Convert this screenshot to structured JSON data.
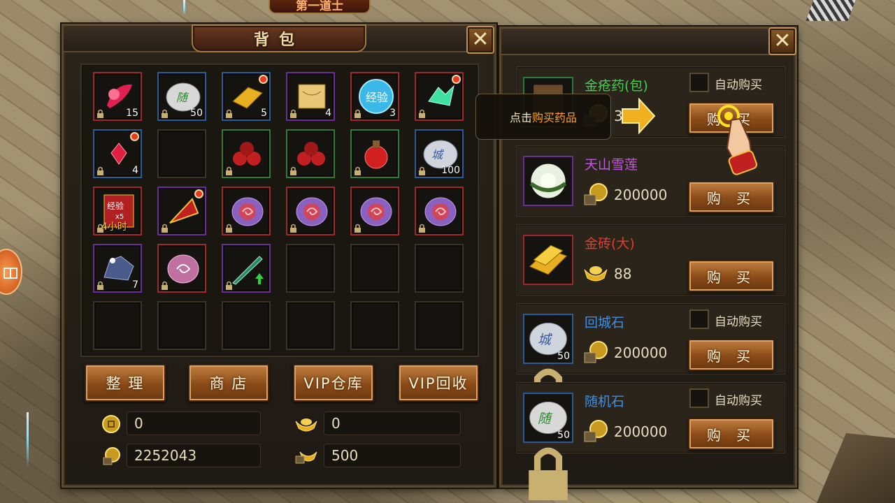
{
  "top_tag": "第一道士",
  "bag": {
    "title": "背包",
    "slots": [
      {
        "count": "15",
        "icon": "red-feather-icon"
      },
      {
        "count": "50",
        "icon": "white-stone-icon"
      },
      {
        "count": "5",
        "icon": "gold-brick-icon"
      },
      {
        "count": "4",
        "icon": "scroll-icon"
      },
      {
        "count": "3",
        "icon": "blue-exp-orb-icon"
      },
      {
        "count": "",
        "icon": "green-crystal-icon"
      },
      {
        "count": "4",
        "icon": "red-gem-icon"
      },
      {
        "count": "",
        "icon": ""
      },
      {
        "count": "",
        "icon": "red-potion-pack-icon"
      },
      {
        "count": "",
        "icon": "red-potion-pack-icon"
      },
      {
        "count": "",
        "icon": "red-potion-icon"
      },
      {
        "count": "100",
        "icon": "town-stone-icon"
      },
      {
        "count": "4小时",
        "icon": "exp-scroll-icon",
        "label": "经验x5"
      },
      {
        "count": "",
        "icon": "flag-icon"
      },
      {
        "count": "",
        "icon": "purple-rune-icon"
      },
      {
        "count": "",
        "icon": "purple-rune-icon"
      },
      {
        "count": "",
        "icon": "purple-rune-icon"
      },
      {
        "count": "",
        "icon": "purple-rune-icon"
      },
      {
        "count": "7",
        "icon": "blue-ore-icon"
      },
      {
        "count": "",
        "icon": "pink-rune-icon"
      },
      {
        "count": "",
        "icon": "jade-sword-icon"
      }
    ],
    "buttons": {
      "sort": "整 理",
      "shop": "商 店",
      "vip_storage": "VIP仓库",
      "vip_recycle": "VIP回收"
    },
    "currency": {
      "coin": "0",
      "ingot": "0",
      "bound_coin": "2252043",
      "bound_ingot": "500"
    }
  },
  "shop": {
    "tooltip": {
      "prefix": "点击",
      "highlight": "购买药品"
    },
    "items": [
      {
        "name": "金疮药(包)",
        "price": "3000",
        "buy": "购 买",
        "auto": "自动购买",
        "color": "#3fd24a"
      },
      {
        "name": "天山雪莲",
        "price": "200000",
        "buy": "购 买",
        "auto": "",
        "color": "#c058e0"
      },
      {
        "name": "金砖(大)",
        "price": "88",
        "buy": "购 买",
        "auto": "",
        "color": "#e83a2a"
      },
      {
        "name": "回城石",
        "price": "200000",
        "buy": "购 买",
        "auto": "自动购买",
        "color": "#3f8fe0",
        "count": "50"
      },
      {
        "name": "随机石",
        "price": "200000",
        "buy": "购 买",
        "auto": "自动购买",
        "color": "#3f8fe0",
        "count": "50"
      }
    ]
  },
  "colors": {
    "highlight": "#ffa020",
    "gold": "#e8b020"
  }
}
